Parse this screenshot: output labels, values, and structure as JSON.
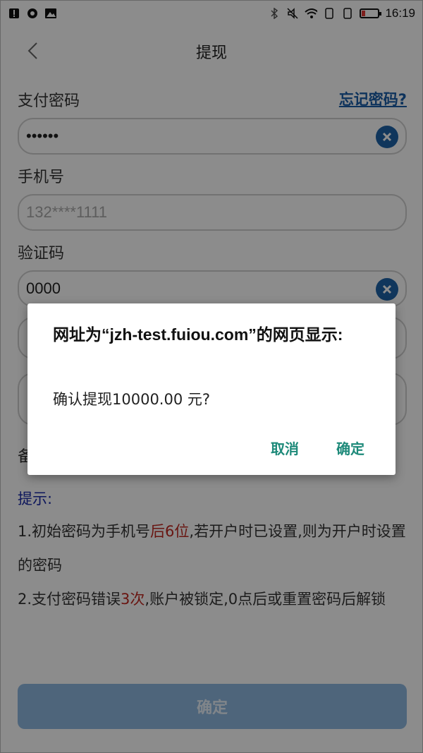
{
  "statusbar": {
    "time": "16:19"
  },
  "header": {
    "title": "提现"
  },
  "form": {
    "pay_password_label": "支付密码",
    "forgot_password_link": "忘记密码?",
    "pay_password_value": "••••••",
    "phone_label": "手机号",
    "phone_placeholder": "132****1111",
    "code_label": "验证码",
    "code_value": "0000",
    "note_label_partial": "备"
  },
  "tips": {
    "title": "提示:",
    "tip1_prefix": "1.初始密码为手机号",
    "tip1_highlight": "后6位",
    "tip1_suffix": ",若开户时已设置,则为开户时设置的密码",
    "tip2_prefix": "2.支付密码错误",
    "tip2_highlight": "3次",
    "tip2_suffix": ",账户被锁定,0点后或重置密码后解锁"
  },
  "main_button": {
    "label": "确定"
  },
  "dialog": {
    "title": "网址为“jzh-test.fuiou.com”的网页显示:",
    "message": "确认提现10000.00  元?",
    "cancel_label": "取消",
    "ok_label": "确定"
  },
  "colors": {
    "accent_blue": "#1e63a8",
    "dialog_button": "#1e8a7a",
    "highlight_red": "#c0271f"
  }
}
